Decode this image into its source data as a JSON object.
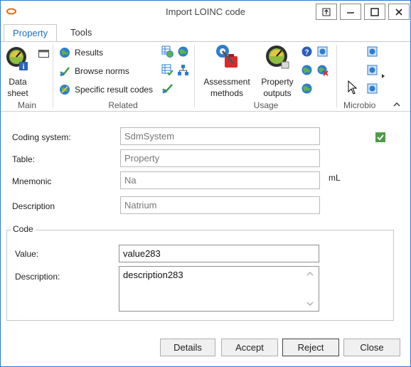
{
  "window": {
    "title": "Import LOINC code",
    "controls": [
      "restore",
      "minimize",
      "maximize",
      "close"
    ]
  },
  "tabs": [
    {
      "label": "Property",
      "active": true
    },
    {
      "label": "Tools",
      "active": false
    }
  ],
  "ribbon": {
    "main": {
      "label": "Main",
      "data_sheet_line1": "Data",
      "data_sheet_line2": "sheet"
    },
    "related": {
      "label": "Related",
      "items": [
        "Results",
        "Browse norms",
        "Specific result codes"
      ]
    },
    "usage": {
      "label": "Usage",
      "assessment_line1": "Assessment",
      "assessment_line2": "methods",
      "property_line1": "Property",
      "property_line2": "outputs"
    },
    "microbio": {
      "label": "Microbio"
    }
  },
  "form": {
    "coding_system": {
      "label": "Coding system:",
      "value": "SdmSystem"
    },
    "table": {
      "label": "Table:",
      "value": "Property"
    },
    "mnemonic": {
      "label": "Mnemonic",
      "value": "Na",
      "unit": "mL"
    },
    "description": {
      "label": "Description",
      "value": "Natrium"
    },
    "checkbox_checked": true
  },
  "code": {
    "group_label": "Code",
    "value_label": "Value:",
    "value": "value283",
    "description_label": "Description:",
    "description": "description283"
  },
  "buttons": {
    "details": "Details",
    "accept": "Accept",
    "reject": "Reject",
    "close": "Close"
  },
  "colors": {
    "accent": "#1e6fc6",
    "window_border": "#2b79d6",
    "checkbox": "#4f9a48"
  }
}
